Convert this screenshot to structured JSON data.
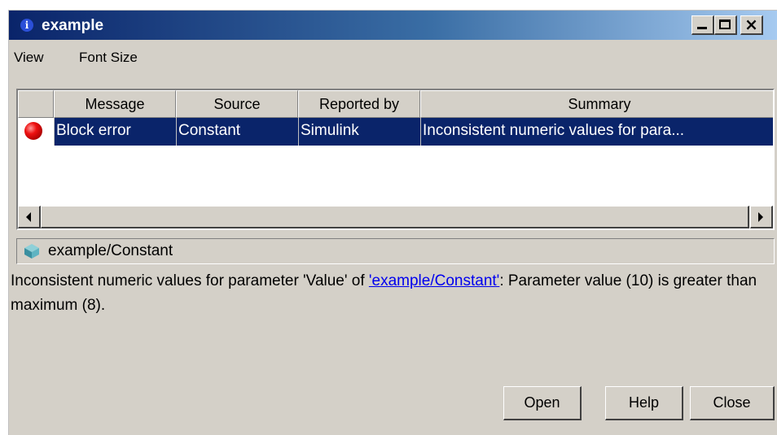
{
  "window": {
    "title": "example",
    "title_icon": "info-icon",
    "controls": {
      "minimize_icon": "minimize-icon",
      "maximize_icon": "maximize-icon",
      "close_icon": "close-icon"
    }
  },
  "menu": {
    "items": [
      "View",
      "Font Size"
    ]
  },
  "table": {
    "columns": [
      "",
      "Message",
      "Source",
      "Reported by",
      "Summary"
    ],
    "rows": [
      {
        "icon": "error-icon",
        "message": "Block error",
        "source": "Constant",
        "reported_by": "Simulink",
        "summary": "Inconsistent numeric values for para..."
      }
    ],
    "selected_row_color": "#0a246a"
  },
  "detail": {
    "path_icon": "block-cube-icon",
    "path": "example/Constant",
    "message_before": "Inconsistent numeric values for parameter 'Value' of ",
    "message_link": "'example/Constant'",
    "message_after": ": Parameter value (10) is greater than maximum (8)."
  },
  "buttons": {
    "open": "Open",
    "help": "Help",
    "close": "Close"
  },
  "colors": {
    "title_gradient_start": "#0a246a",
    "title_gradient_end": "#a6caf0",
    "window_bg": "#d4d0c8",
    "link": "#0000ee"
  }
}
